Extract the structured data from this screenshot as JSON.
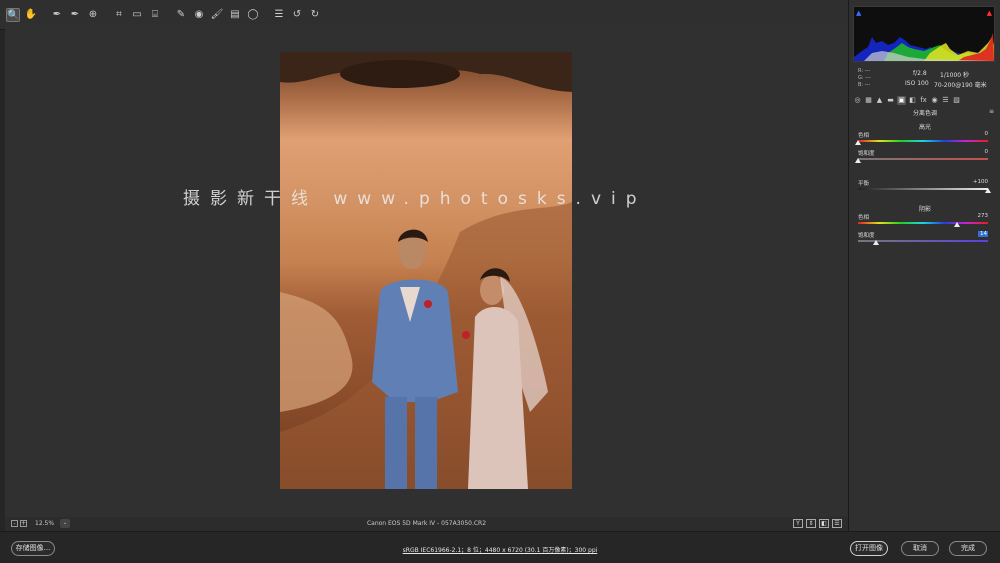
{
  "toolbar": {
    "tools": [
      {
        "name": "zoom-tool",
        "glyph": "🔍",
        "active": true
      },
      {
        "name": "hand-tool",
        "glyph": "✋",
        "active": false
      },
      {
        "name": "white-balance-tool",
        "glyph": "✒",
        "active": false
      },
      {
        "name": "color-sampler-tool",
        "glyph": "✒",
        "active": false
      },
      {
        "name": "targeted-adjustment-tool",
        "glyph": "⊕",
        "active": false
      },
      {
        "name": "crop-tool",
        "glyph": "⌗",
        "active": false
      },
      {
        "name": "straighten-tool",
        "glyph": "▭",
        "active": false
      },
      {
        "name": "transform-tool",
        "glyph": "⌸",
        "active": false
      },
      {
        "name": "spot-removal-tool",
        "glyph": "✎",
        "active": false
      },
      {
        "name": "red-eye-tool",
        "glyph": "◉",
        "active": false
      },
      {
        "name": "adjustment-brush-tool",
        "glyph": "🖌",
        "active": false
      },
      {
        "name": "graduated-filter-tool",
        "glyph": "▤",
        "active": false
      },
      {
        "name": "radial-filter-tool",
        "glyph": "◯",
        "active": false
      },
      {
        "name": "preferences-tool",
        "glyph": "☰",
        "active": false
      },
      {
        "name": "rotate-left-tool",
        "glyph": "↺",
        "active": false
      },
      {
        "name": "rotate-right-tool",
        "glyph": "↻",
        "active": false
      }
    ],
    "export_glyph": "⇥"
  },
  "canvas": {
    "watermark": "摄影新干线 www.photosks.vip",
    "zoom_level": "12.5%",
    "zoom_minus": "-",
    "zoom_plus": "+",
    "zoom_dropdown": "⌄",
    "camera_info": "Canon EOS 5D Mark IV -  057A3050.CR2",
    "view_buttons": [
      "Y",
      "⇕",
      "◧",
      "☰"
    ]
  },
  "histogram": {
    "clip_shadow": "▲",
    "clip_highlight": "▲",
    "readout": {
      "r": "R:   ---",
      "g": "G:   ---",
      "b": "B:   ---"
    },
    "exif": {
      "aperture": "f/2.8",
      "shutter": "1/1000 秒",
      "iso": "ISO 100",
      "lens": "70-200@190 毫米"
    }
  },
  "panel": {
    "tabs": [
      "◎",
      "▦",
      "▲",
      "▬",
      "▣",
      "◧",
      "fx",
      "◉",
      "☰",
      "▧"
    ],
    "section_title": "分离色调",
    "menu_glyph": "≡",
    "highlights": {
      "title": "高光",
      "hue": {
        "label": "色相",
        "value": "0",
        "level": 0.0
      },
      "saturation": {
        "label": "饱和度",
        "value": "0",
        "level": 0.0
      }
    },
    "balance": {
      "label": "平衡",
      "value": "+100",
      "level": 1.0
    },
    "shadows": {
      "title": "阴影",
      "hue": {
        "label": "色相",
        "value": "273",
        "level": 0.7583
      },
      "saturation": {
        "label": "饱和度",
        "value": "14",
        "level": 0.14
      }
    }
  },
  "footer": {
    "save": "存储图像...",
    "workflow": "sRGB IEC61966-2.1；8 位；4480 x 6720 (30.1 百万像素)；300 ppi",
    "open": "打开图像",
    "cancel": "取消",
    "done": "完成"
  }
}
